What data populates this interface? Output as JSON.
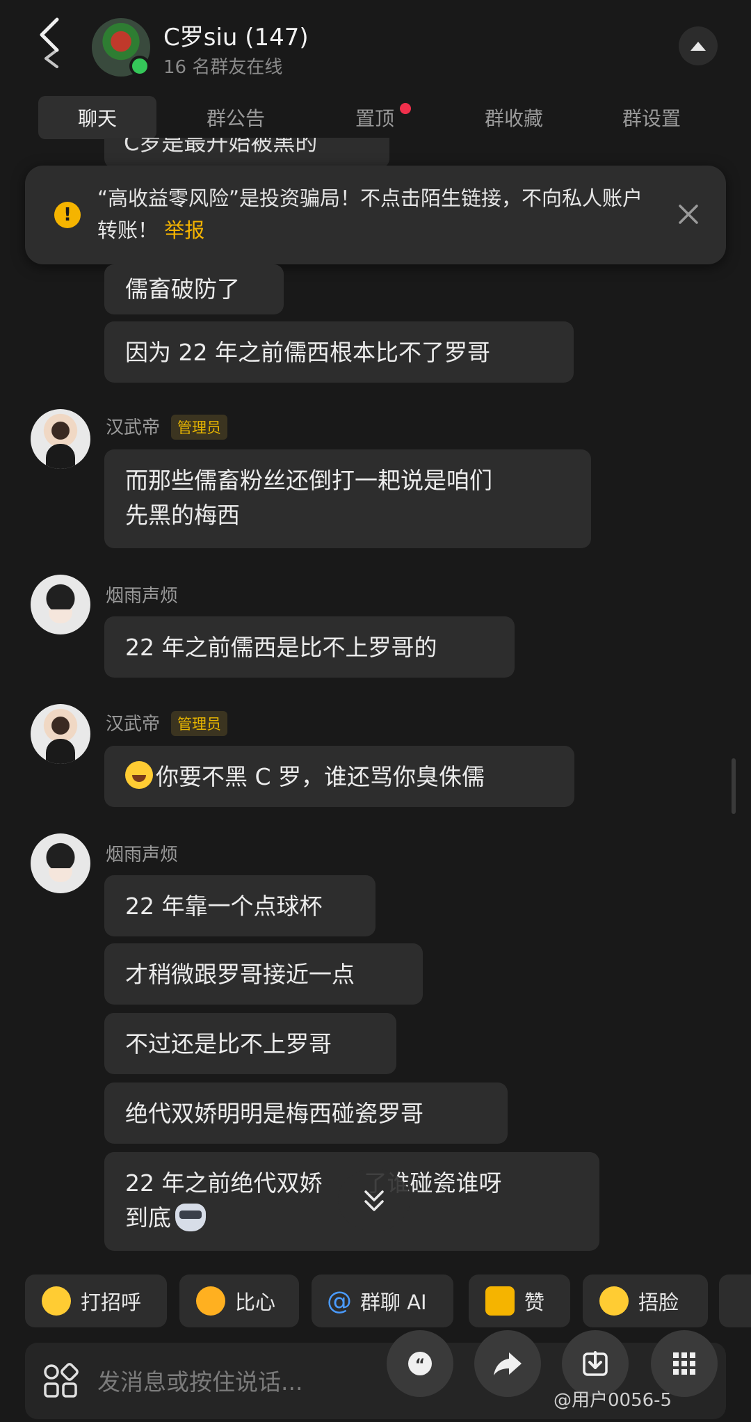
{
  "header": {
    "title": "C罗siu (147)",
    "subtitle": "16 名群友在线"
  },
  "tabs": [
    {
      "label": "聊天",
      "active": true
    },
    {
      "label": "群公告"
    },
    {
      "label": "置顶",
      "has_dot": true
    },
    {
      "label": "群收藏"
    },
    {
      "label": "群设置"
    }
  ],
  "partial_message": "C罗是最开始被黑的",
  "warning": {
    "text": "“高收益零风险”是投资骗局！不点击陌生链接，不向私人账户转账！",
    "link": "举报"
  },
  "messages": {
    "m1": "儒畜破防了",
    "m2": "因为 22 年之前儒西根本比不了罗哥",
    "g2_sender": "汉武帝",
    "g2_badge": "管理员",
    "m3a": "而那些儒畜粉丝还倒打一耙说是咱们",
    "m3b": "先黑的梅西",
    "g3_sender": "烟雨声烦",
    "m4": "22 年之前儒西是比不上罗哥的",
    "g4_sender": "汉武帝",
    "g4_badge": "管理员",
    "m5": "你要不黑 C 罗，谁还骂你臭侏儒",
    "g5_sender": "烟雨声烦",
    "m6": "22 年靠一个点球杯",
    "m7": "才稍微跟罗哥接近一点",
    "m8": "不过还是比不上罗哥",
    "m9": "绝代双娇明明是梅西碰瓷罗哥",
    "m10a": "22 年之前绝代双娇",
    "m10b": "了谁碰瓷谁呀",
    "m10c": "到底"
  },
  "quick_replies": [
    "打招呼",
    "比心",
    "群聊 AI",
    "赞",
    "捂脸"
  ],
  "input": {
    "placeholder": "发消息或按住说话..."
  },
  "watermark": "@用户0056-5",
  "colors": {
    "background": "#191919",
    "bubble": "#2d2d2d",
    "accent_warning": "#f5b400",
    "online": "#35c759",
    "badge_text": "#e8b600",
    "notify_dot": "#f0304c"
  }
}
